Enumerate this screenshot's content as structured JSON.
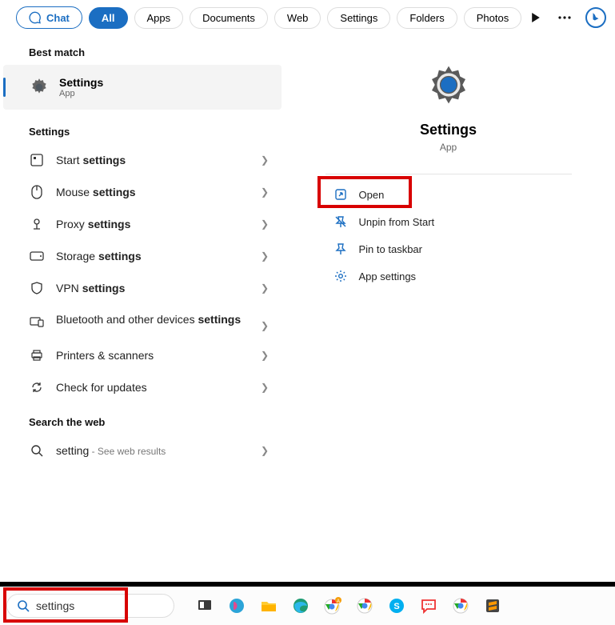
{
  "top": {
    "chat": "Chat",
    "pills": [
      "All",
      "Apps",
      "Documents",
      "Web",
      "Settings",
      "Folders",
      "Photos"
    ]
  },
  "left": {
    "best_match_label": "Best match",
    "result_title": "Settings",
    "result_sub": "App",
    "settings_label": "Settings",
    "items": [
      {
        "pre": "Start ",
        "bold": "settings"
      },
      {
        "pre": "Mouse ",
        "bold": "settings"
      },
      {
        "pre": "Proxy ",
        "bold": "settings"
      },
      {
        "pre": "Storage ",
        "bold": "settings"
      },
      {
        "pre": "VPN ",
        "bold": "settings"
      },
      {
        "pre": "Bluetooth and other devices ",
        "bold": "settings"
      },
      {
        "pre": "Printers & scanners",
        "bold": ""
      },
      {
        "pre": "Check for updates",
        "bold": ""
      }
    ],
    "search_web_label": "Search the web",
    "web_pre": "setting",
    "web_hint": " - See web results"
  },
  "right": {
    "title": "Settings",
    "sub": "App",
    "open": "Open",
    "unpin": "Unpin from Start",
    "pin_tb": "Pin to taskbar",
    "app_settings": "App settings"
  },
  "search": {
    "value": "settings"
  }
}
